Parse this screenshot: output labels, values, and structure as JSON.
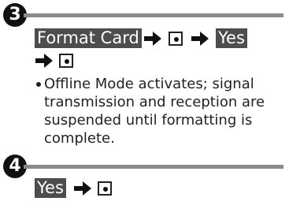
{
  "step3": {
    "number": "3",
    "action1": "Format Card",
    "action2": "Yes",
    "note_line1": "Offline Mode activates; signal",
    "note_line2": "transmission and reception are",
    "note_line3": "suspended until formatting is",
    "note_line4": "complete."
  },
  "step4": {
    "number": "4",
    "action1": "Yes"
  },
  "icons": {
    "arrow": "right-arrow-icon",
    "key": "center-key-icon"
  }
}
